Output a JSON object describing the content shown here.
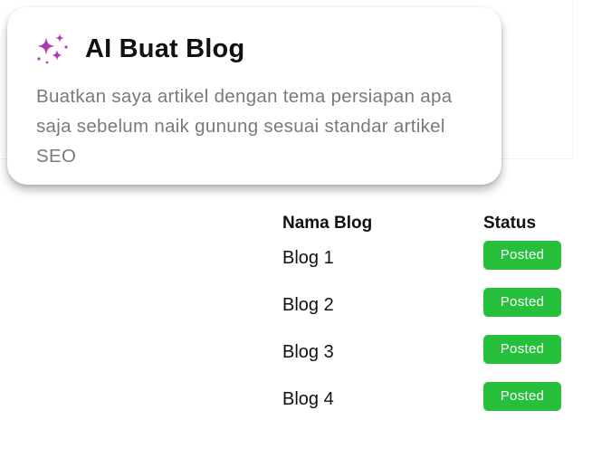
{
  "prompt_card": {
    "icon": "sparkles-icon",
    "title": "AI Buat Blog",
    "prompt_text": "Buatkan saya artikel dengan tema persiapan apa saja sebelum naik gunung sesuai standar artikel SEO",
    "icon_color": "#9b3fc5"
  },
  "blog_table": {
    "headers": {
      "name": "Nama Blog",
      "status": "Status"
    },
    "rows": [
      {
        "name": "Blog 1",
        "status": "Posted"
      },
      {
        "name": "Blog 2",
        "status": "Posted"
      },
      {
        "name": "Blog 3",
        "status": "Posted"
      },
      {
        "name": "Blog 4",
        "status": "Posted"
      }
    ],
    "status_color": "#27c03c"
  }
}
